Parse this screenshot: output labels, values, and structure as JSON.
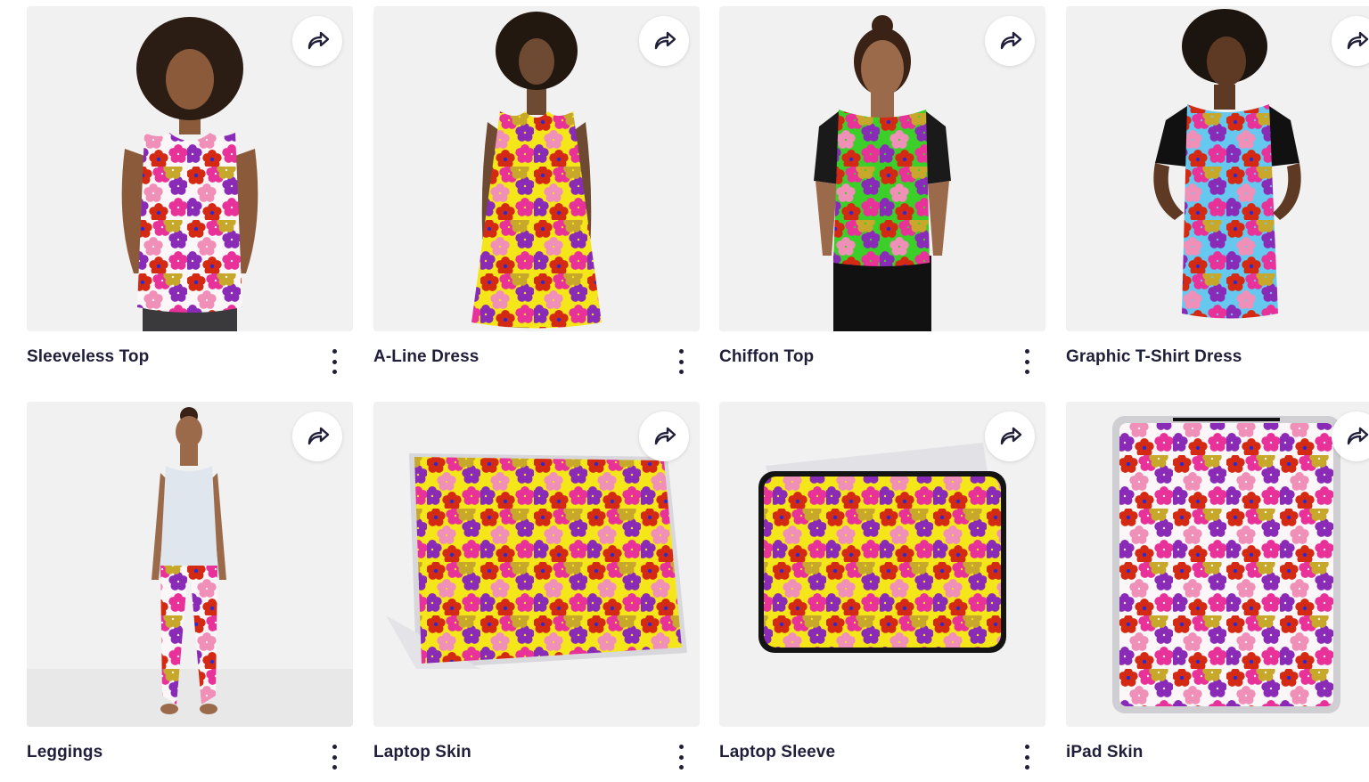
{
  "products": [
    {
      "title": "Sleeveless Top",
      "pattern": "white"
    },
    {
      "title": "A-Line Dress",
      "pattern": "yellow"
    },
    {
      "title": "Chiffon Top",
      "pattern": "green"
    },
    {
      "title": "Graphic T-Shirt Dress",
      "pattern": "blue"
    },
    {
      "title": "Leggings",
      "pattern": "white"
    },
    {
      "title": "Laptop Skin",
      "pattern": "yellow"
    },
    {
      "title": "Laptop Sleeve",
      "pattern": "yellow"
    },
    {
      "title": "iPad Skin",
      "pattern": "white"
    }
  ],
  "icons": {
    "share": "share-arrow-icon",
    "more": "more-vertical-icon"
  },
  "colors": {
    "text": "#1f1f3a",
    "card_bg": "#f2f2f2",
    "pattern_white": "#fbf7f9",
    "pattern_yellow": "#f5e619",
    "pattern_green": "#3ccf2a",
    "pattern_blue": "#66c8ee",
    "flower_red": "#d42a14",
    "flower_pink": "#e8329a",
    "flower_purple": "#8a2bb8",
    "flower_gold": "#c8a82a",
    "flower_lightpink": "#f08fb8"
  }
}
